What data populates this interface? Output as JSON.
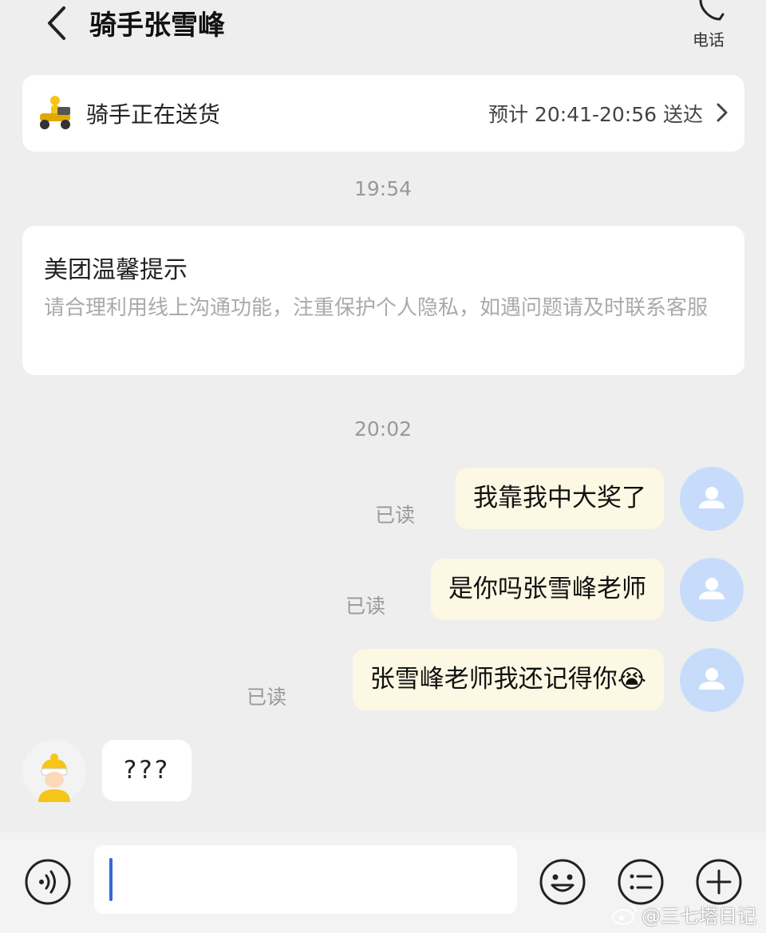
{
  "header": {
    "title": "骑手张雪峰",
    "phone_label": "电话"
  },
  "status_card": {
    "status": "骑手正在送货",
    "eta": "预计 20:41-20:56 送达"
  },
  "timestamps": [
    "19:54",
    "20:02"
  ],
  "tip_card": {
    "title": "美团温馨提示",
    "body": "请合理利用线上沟通功能，注重保护个人隐私，如遇问题请及时联系客服"
  },
  "messages_out": [
    {
      "text": "我靠我中大奖了",
      "read": "已读"
    },
    {
      "text": "是你吗张雪峰老师",
      "read": "已读"
    },
    {
      "text": "张雪峰老师我还记得你😭",
      "read": "已读"
    }
  ],
  "message_in": {
    "text": "???"
  },
  "input": {
    "value": "",
    "placeholder": ""
  },
  "watermark": "@三七塔日记",
  "colors": {
    "background": "#eeeeee",
    "card": "#ffffff",
    "bubble_out": "#fdf8e3",
    "avatar_user": "#c7dcfb",
    "cursor": "#3467d9",
    "tip_text": "#aaaaaa"
  }
}
